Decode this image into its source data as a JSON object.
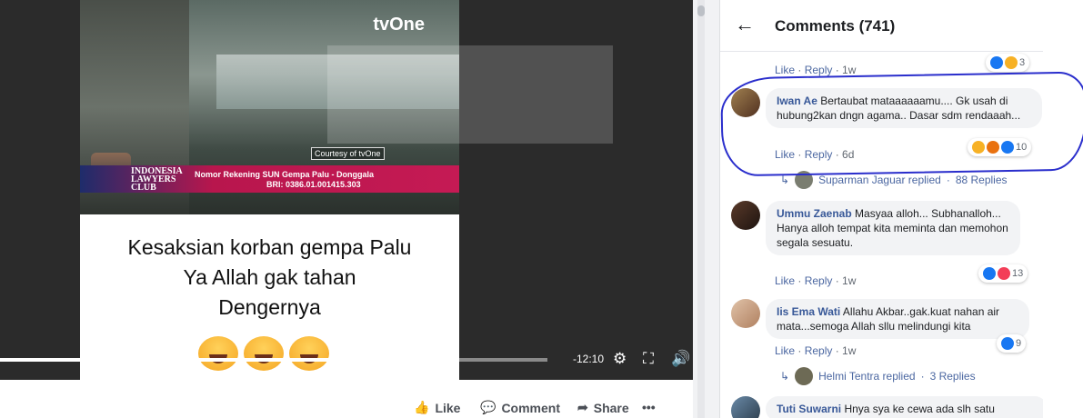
{
  "video": {
    "channel_logo": "tvOne",
    "courtesy": "Courtesy of tvOne",
    "ticker": {
      "logo_text": "INDONESIA LAWYERS CLUB",
      "line1": "Nomor Rekening SUN Gempa Palu - Donggala",
      "line2": "BRI: 0386.01.001415.303"
    },
    "caption_lines": [
      "Kesaksian korban gempa Palu",
      "Ya Allah gak tahan",
      "Dengernya"
    ],
    "emoji_icons": [
      "crying-laughing-face-icon",
      "crying-laughing-face-icon",
      "crying-laughing-face-icon"
    ],
    "time_remaining": "-12:10",
    "progress": 0.79,
    "controls": [
      "gear-icon",
      "fullscreen-icon",
      "volume-icon"
    ]
  },
  "actions": {
    "like": "Like",
    "comment": "Comment",
    "share": "Share",
    "more": "•••"
  },
  "comments": {
    "title": "Comments (741)",
    "top_partial": {
      "like": "Like",
      "reply": "Reply",
      "age": "1w",
      "reaction_count": "3"
    },
    "items": [
      {
        "name": "Iwan Ae",
        "text": "Bertaubat mataaaaaamu.... Gk usah di hubung2kan dngn agama.. Dasar sdm rendaaah...",
        "like": "Like",
        "reply": "Reply",
        "age": "6d",
        "reaction_count": "10",
        "replies": {
          "who": "Suparman Jaguar replied",
          "count": "88 Replies"
        }
      },
      {
        "name": "Ummu Zaenab",
        "text": "Masyaa alloh... Subhanalloh... Hanya alloh tempat kita meminta dan memohon segala sesuatu.",
        "like": "Like",
        "reply": "Reply",
        "age": "1w",
        "reaction_count": "13"
      },
      {
        "name": "Iis Ema Wati",
        "text": "Allahu Akbar..gak.kuat nahan air mata...semoga Allah sllu melindungi kita",
        "like": "Like",
        "reply": "Reply",
        "age": "1w",
        "reaction_count": "9",
        "replies": {
          "who": "Helmi Tentra replied",
          "count": "3 Replies"
        }
      },
      {
        "name": "Tuti Suwarni",
        "text": "Hnya sya ke cewa ada slh satu"
      }
    ]
  },
  "colors": {
    "link_blue": "#385898",
    "annotation_blue": "#2a2ecc",
    "bubble_gray": "#f2f3f5"
  }
}
